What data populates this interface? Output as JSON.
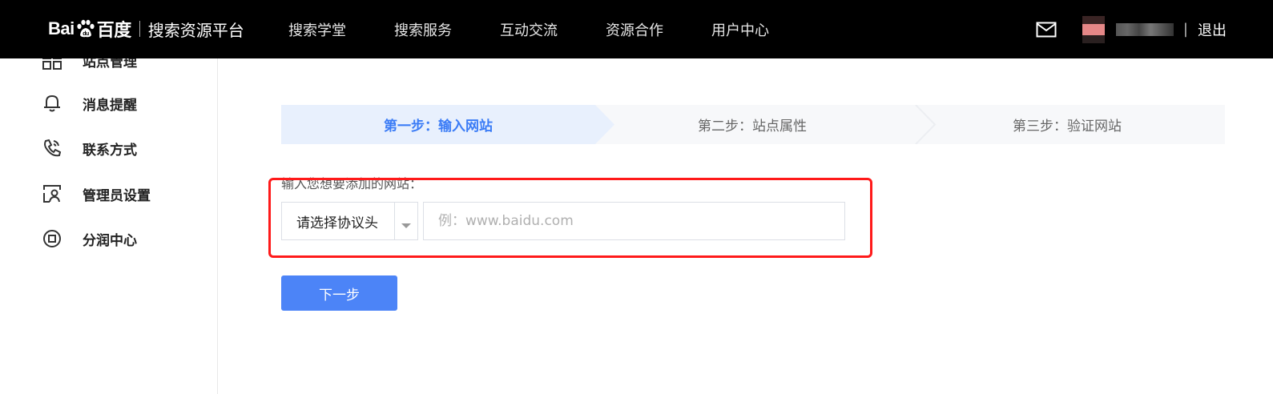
{
  "header": {
    "logo_text_left": "Bai",
    "logo_text_right": "百度",
    "platform_title": "搜索资源平台",
    "nav": [
      {
        "label": "搜索学堂"
      },
      {
        "label": "搜索服务"
      },
      {
        "label": "互动交流"
      },
      {
        "label": "资源合作"
      },
      {
        "label": "用户中心"
      }
    ],
    "separator": "|",
    "logout_label": "退出",
    "icons": {
      "mail": "mail-icon",
      "avatar": "avatar"
    }
  },
  "sidebar": {
    "items": [
      {
        "label": "站点管理",
        "icon": "grid-icon"
      },
      {
        "label": "消息提醒",
        "icon": "bell-icon"
      },
      {
        "label": "联系方式",
        "icon": "phone-icon"
      },
      {
        "label": "管理员设置",
        "icon": "admin-card-icon"
      },
      {
        "label": "分润中心",
        "icon": "revenue-circle-icon"
      }
    ]
  },
  "steps": [
    {
      "label": "第一步：输入网站",
      "active": true
    },
    {
      "label": "第二步：站点属性",
      "active": false
    },
    {
      "label": "第三步：验证网站",
      "active": false
    }
  ],
  "form": {
    "label": "输入您想要添加的网站：",
    "protocol_select": {
      "value": "请选择协议头"
    },
    "url_input": {
      "value": "",
      "placeholder": "例：www.baidu.com"
    },
    "next_button": "下一步"
  },
  "colors": {
    "topbar": "#000000",
    "accent": "#4c84f7",
    "step_active_text": "#3b7cf6",
    "step_active_bg": "#e8f0fd",
    "highlight": "#ff1a1a"
  }
}
